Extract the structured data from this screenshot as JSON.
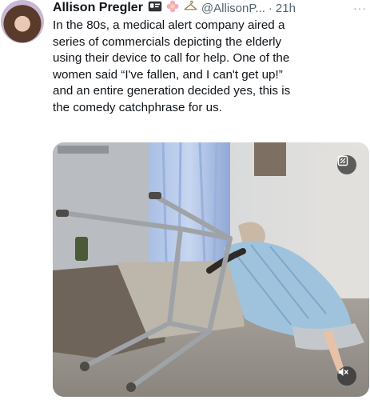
{
  "tweet": {
    "author_name": "Allison Pregler",
    "handle": "@AllisonP...",
    "separator": "·",
    "time": "21h",
    "more_label": "···",
    "text": "In the 80s, a medical alert company aired a\nseries of commercials depicting the elderly\nusing their device to call for help. One of the\nwomen said “I've fallen, and I can't get up!”\nand an entire generation decided yes, this is\nthe comedy catchphrase for us."
  },
  "icons": {
    "badge": "id-card-icon",
    "flower": "flower-icon",
    "hanger": "hanger-icon",
    "gif_toggle": "gif-control-icon",
    "audio": "speaker-muted-icon"
  },
  "colors": {
    "text": "#0f1419",
    "muted": "#536471",
    "overlay": "#282828"
  }
}
